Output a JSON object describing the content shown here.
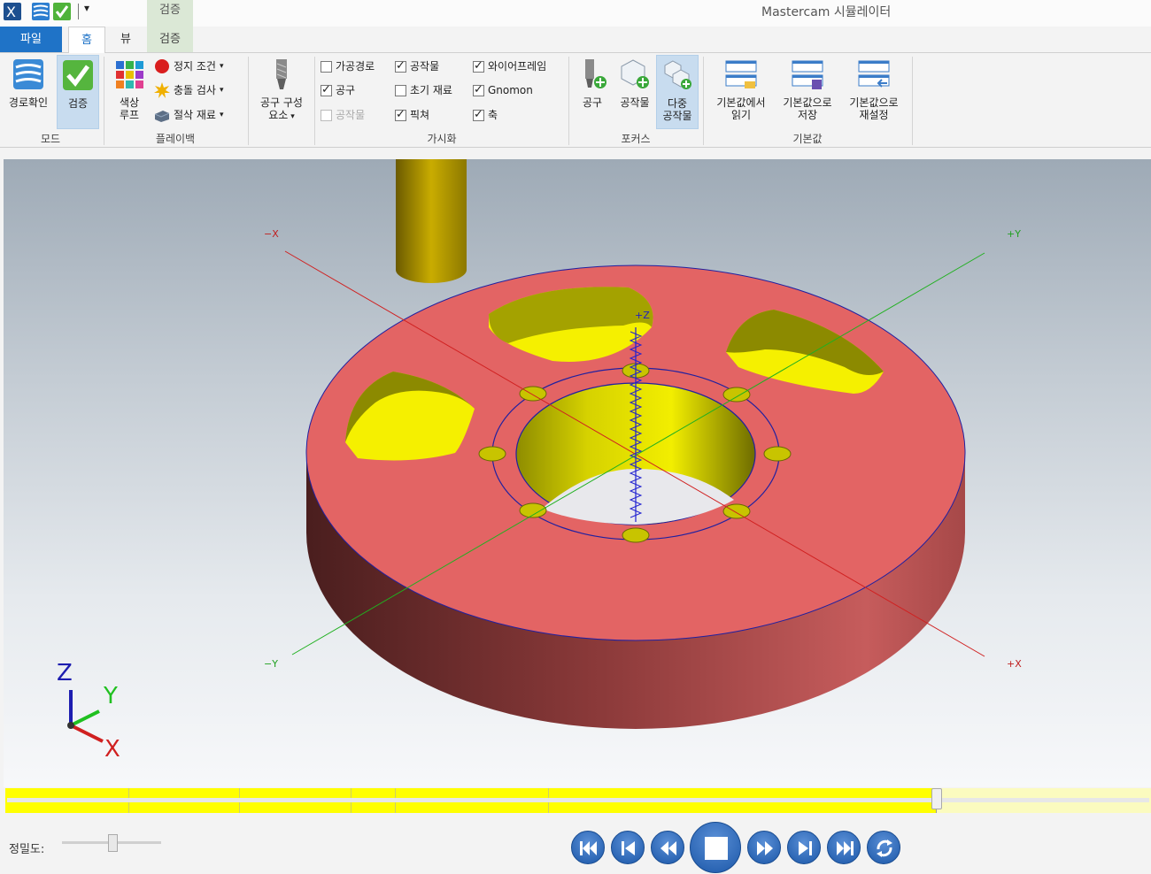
{
  "window": {
    "title": "Mastercam 시뮬레이터",
    "context_tab_label": "검증"
  },
  "tabs": {
    "file": "파일",
    "home": "홈",
    "view": "뷰",
    "verify": "검증"
  },
  "ribbon": {
    "mode": {
      "group_label": "모드",
      "backplot_label": "경로확인",
      "verify_label": "검증"
    },
    "playback": {
      "group_label": "플레이백",
      "color_loop_label_1": "색상",
      "color_loop_label_2": "루프",
      "stop_conditions_label": "정지 조건",
      "collision_check_label": "충돌 검사",
      "cut_stock_label": "절삭 재료"
    },
    "tool_components": {
      "label_1": "공구 구성",
      "label_2": "요소"
    },
    "visibility": {
      "group_label": "가시화",
      "toolpath": {
        "label": "가공경로",
        "checked": false
      },
      "tool": {
        "label": "공구",
        "checked": true
      },
      "workpiece_disabled": {
        "label": "공작물",
        "checked": false
      },
      "workpiece": {
        "label": "공작물",
        "checked": true
      },
      "initial_stock": {
        "label": "초기 재료",
        "checked": false
      },
      "fixture": {
        "label": "픽쳐",
        "checked": true
      },
      "wireframe": {
        "label": "와이어프레임",
        "checked": true
      },
      "gnomon": {
        "label": "Gnomon",
        "checked": true
      },
      "axes": {
        "label": "축",
        "checked": true
      }
    },
    "focus": {
      "group_label": "포커스",
      "tool_label": "공구",
      "workpiece_label": "공작물",
      "multi_label_1": "다중",
      "multi_label_2": "공작물"
    },
    "defaults": {
      "group_label": "기본값",
      "load_label_1": "기본값에서",
      "load_label_2": "읽기",
      "save_label_1": "기본값으로",
      "save_label_2": "저장",
      "reset_label_1": "기본값으로",
      "reset_label_2": "재설정"
    }
  },
  "viewport": {
    "axis_labels": {
      "neg_x": "−X",
      "pos_y": "+Y",
      "pos_z": "+Z",
      "neg_y": "−Y",
      "pos_x": "+X"
    },
    "gnomon": {
      "z": "Z",
      "y": "Y",
      "x": "X"
    },
    "colors": {
      "part_top": "#e36464",
      "part_side": "#b55050",
      "pocket": "#f5f000",
      "tool": "#c8b000",
      "x_axis": "#d02020",
      "y_axis": "#20b020",
      "z_axis": "#2020d0"
    }
  },
  "timeline": {
    "progress": 0.812
  },
  "bottom": {
    "precision_label": "정밀도:",
    "precision_level": 0.5,
    "buttons": [
      "go-start-icon",
      "step-back-icon",
      "rewind-icon",
      "stop-icon",
      "fast-forward-icon",
      "step-forward-icon",
      "go-end-icon",
      "loop-icon"
    ]
  }
}
